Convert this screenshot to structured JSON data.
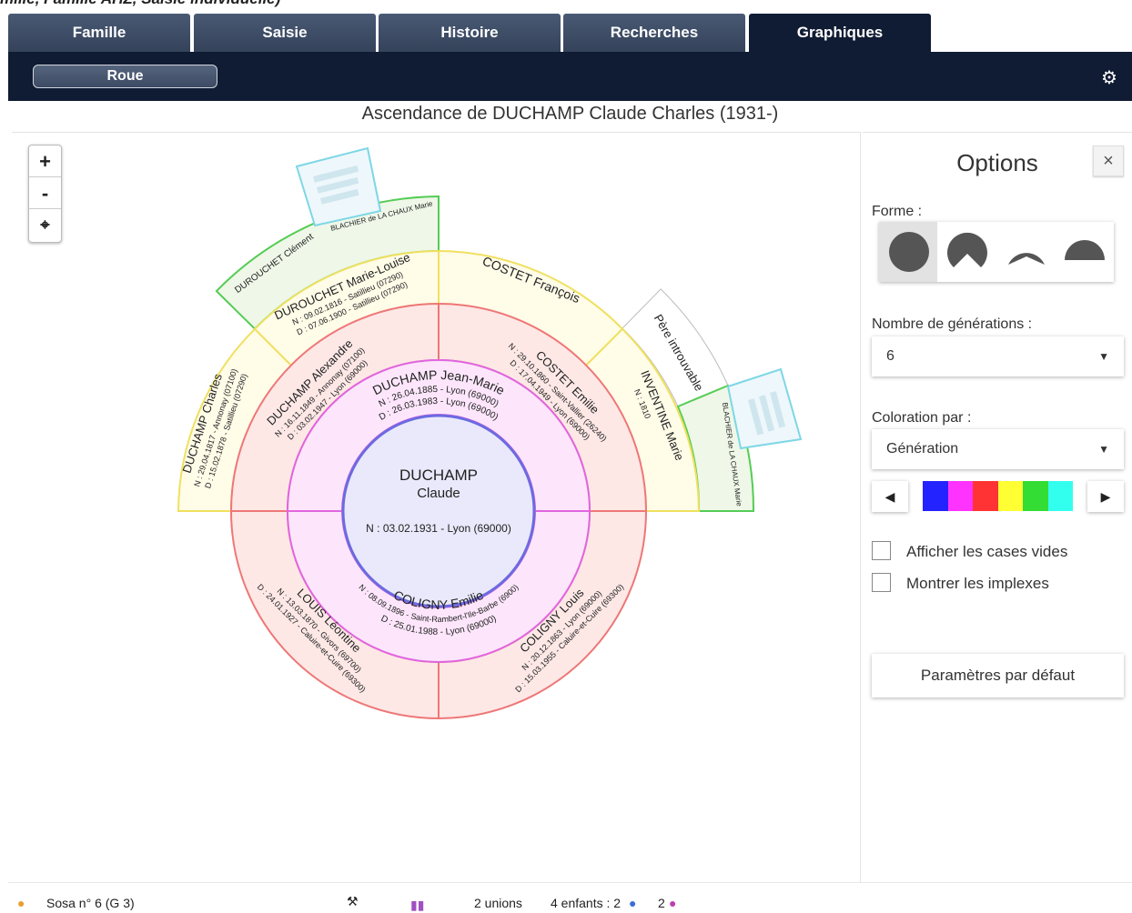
{
  "top_partial": "mille, Famille AHZ, Saisie individuelle)",
  "tabs": [
    "Famille",
    "Saisie",
    "Histoire",
    "Recherches",
    "Graphiques"
  ],
  "toolbar": {
    "view_button": "Roue"
  },
  "chart": {
    "title": "Ascendance de DUCHAMP Claude Charles (1931-)",
    "root": {
      "surname": "DUCHAMP",
      "given": "Claude",
      "birth": "N : 03.02.1931 - Lyon (69000)"
    },
    "gen2": {
      "father": {
        "name": "DUCHAMP Jean-Marie",
        "birth": "N : 26.04.1885 - Lyon (69000)",
        "death": "D : 26.03.1983 - Lyon (69000)"
      },
      "mother": {
        "name": "COLIGNY Emilie",
        "birth": "N : 08.09.1896 - Saint-Rambert-l'Ile-Barbe (6900)",
        "death": "D : 25.01.1988 - Lyon (69000)"
      }
    },
    "gen3": {
      "ff": {
        "name": "DUCHAMP Alexandre",
        "birth": "N : 16.11.1849 - Annonay (07100)",
        "death": "D : 03.02.1947 - Lyon (69000)"
      },
      "fm": {
        "name": "COSTET Emilie",
        "birth": "N : 29.10.1860 - Saint-Vallier (26240)",
        "death": "D : 17.04.1949 - Lyon (69000)"
      },
      "mf": {
        "name": "COLIGNY Louis",
        "birth": "N : 20.12.1863 - Lyon (69000)",
        "death": "D : 15.03.1955 - Caluire-et-Cuire (69300)"
      },
      "mm": {
        "name": "LOUIS Léontine",
        "birth": "N : 13.03.1870 - Givors (69700)",
        "death": "D : 24.01.1927 - Caluire-et-Cuire (69300)"
      }
    },
    "gen4": {
      "fff": {
        "name": "DUCHAMP Charles",
        "birth": "N : 29.04.1817 - Annonay (07100)",
        "death": "D : 15.02.1878 - Satillieu (07290)"
      },
      "ffm": {
        "name": "DUROUCHET Marie-Louise",
        "birth": "N : 09.02.1816 - Satillieu (07290)",
        "death": "D : 07.06.1900 - Satillieu (07290)"
      },
      "fmf": {
        "name": "COSTET François"
      },
      "fmm": {
        "name": "INVENTINE Marie",
        "birth": "N : 1810"
      }
    },
    "gen5": {
      "ffmf": {
        "name": "DUROUCHET Clément"
      },
      "ffmm": {
        "name": "BLACHIER de LA CHAUX Marie"
      },
      "fmmf": {
        "name": "Père introuvable"
      },
      "fmmm": {
        "name": "BLACHIER de LA CHAUX Marie"
      }
    }
  },
  "zoom": {
    "in": "+",
    "out": "-"
  },
  "options": {
    "title": "Options",
    "close": "×",
    "forme_label": "Forme :",
    "generations_label": "Nombre de générations :",
    "generations_value": "6",
    "coloration_label": "Coloration par :",
    "coloration_value": "Génération",
    "palette": [
      "#2323ff",
      "#ff33ff",
      "#ff3333",
      "#ffff33",
      "#33dd33",
      "#33ffee"
    ],
    "show_empty": "Afficher les cases vides",
    "show_implex": "Montrer les implexes",
    "reset": "Paramètres par défaut"
  },
  "status": {
    "sosa": "Sosa n° 6 (G 3)",
    "unions": "2 unions",
    "children": "4 enfants : 2",
    "daughters": "2"
  }
}
